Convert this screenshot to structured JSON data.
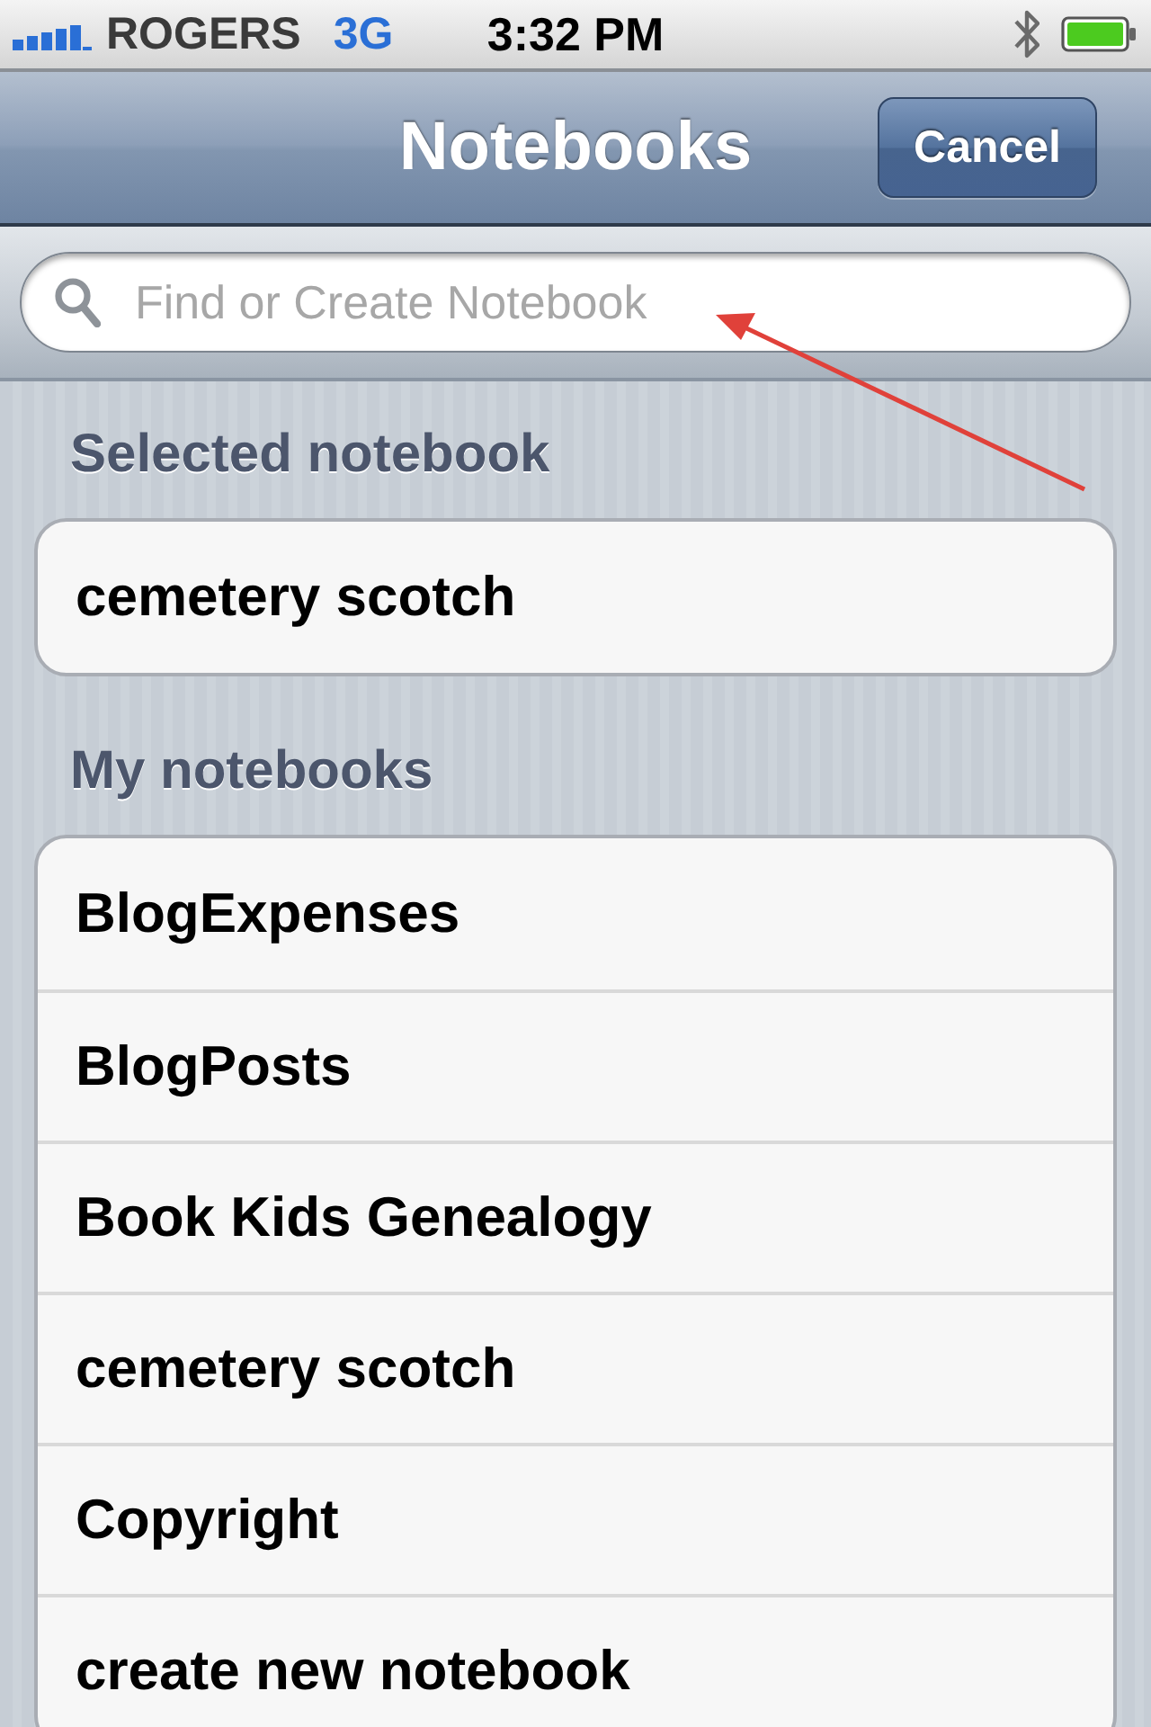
{
  "status_bar": {
    "carrier": "ROGERS",
    "network": "3G",
    "time": "3:32 PM"
  },
  "nav_bar": {
    "title": "Notebooks",
    "cancel_button": "Cancel"
  },
  "search": {
    "placeholder": "Find or Create Notebook"
  },
  "sections": [
    {
      "header": "Selected notebook",
      "items": [
        {
          "label": "cemetery scotch"
        }
      ]
    },
    {
      "header": "My notebooks",
      "items": [
        {
          "label": "BlogExpenses"
        },
        {
          "label": "BlogPosts"
        },
        {
          "label": "Book Kids Genealogy"
        },
        {
          "label": "cemetery scotch"
        },
        {
          "label": "Copyright"
        },
        {
          "label": "create new notebook"
        }
      ]
    }
  ]
}
